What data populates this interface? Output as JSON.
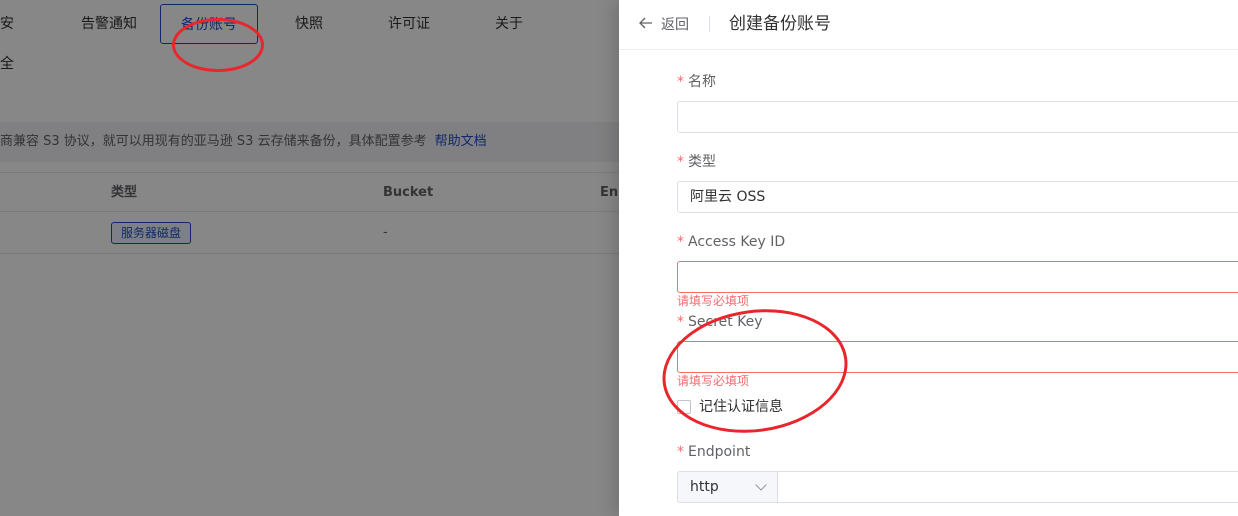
{
  "tabs": [
    {
      "label": "安全",
      "active": false
    },
    {
      "label": "告警通知",
      "active": false
    },
    {
      "label": "备份账号",
      "active": true
    },
    {
      "label": "快照",
      "active": false
    },
    {
      "label": "许可证",
      "active": false
    },
    {
      "label": "关于",
      "active": false
    }
  ],
  "notice": {
    "text": "商兼容 S3 协议，就可以用现有的亚马逊 S3 云存储来备份，具体配置参考",
    "link": "帮助文档"
  },
  "table": {
    "headers": [
      "类型",
      "Bucket",
      "En"
    ],
    "rows": [
      {
        "type_tag": "服务器磁盘",
        "bucket": "-"
      }
    ]
  },
  "drawer": {
    "back_label": "返回",
    "title": "创建备份账号",
    "fields": {
      "name": {
        "label": "名称",
        "value": ""
      },
      "type": {
        "label": "类型",
        "value": "阿里云 OSS"
      },
      "access_key_id": {
        "label": "Access Key ID",
        "value": "",
        "error": "请填写必填项"
      },
      "secret_key": {
        "label": "Secret Key",
        "value": "",
        "error": "请填写必填项"
      },
      "remember": {
        "label": "记住认证信息",
        "checked": false
      },
      "endpoint": {
        "label": "Endpoint",
        "protocol": "http",
        "value": ""
      }
    },
    "required_mark": "*"
  },
  "colors": {
    "accent": "#1d4fc4",
    "error": "#f56c6c",
    "annotation": "#e8262b"
  }
}
